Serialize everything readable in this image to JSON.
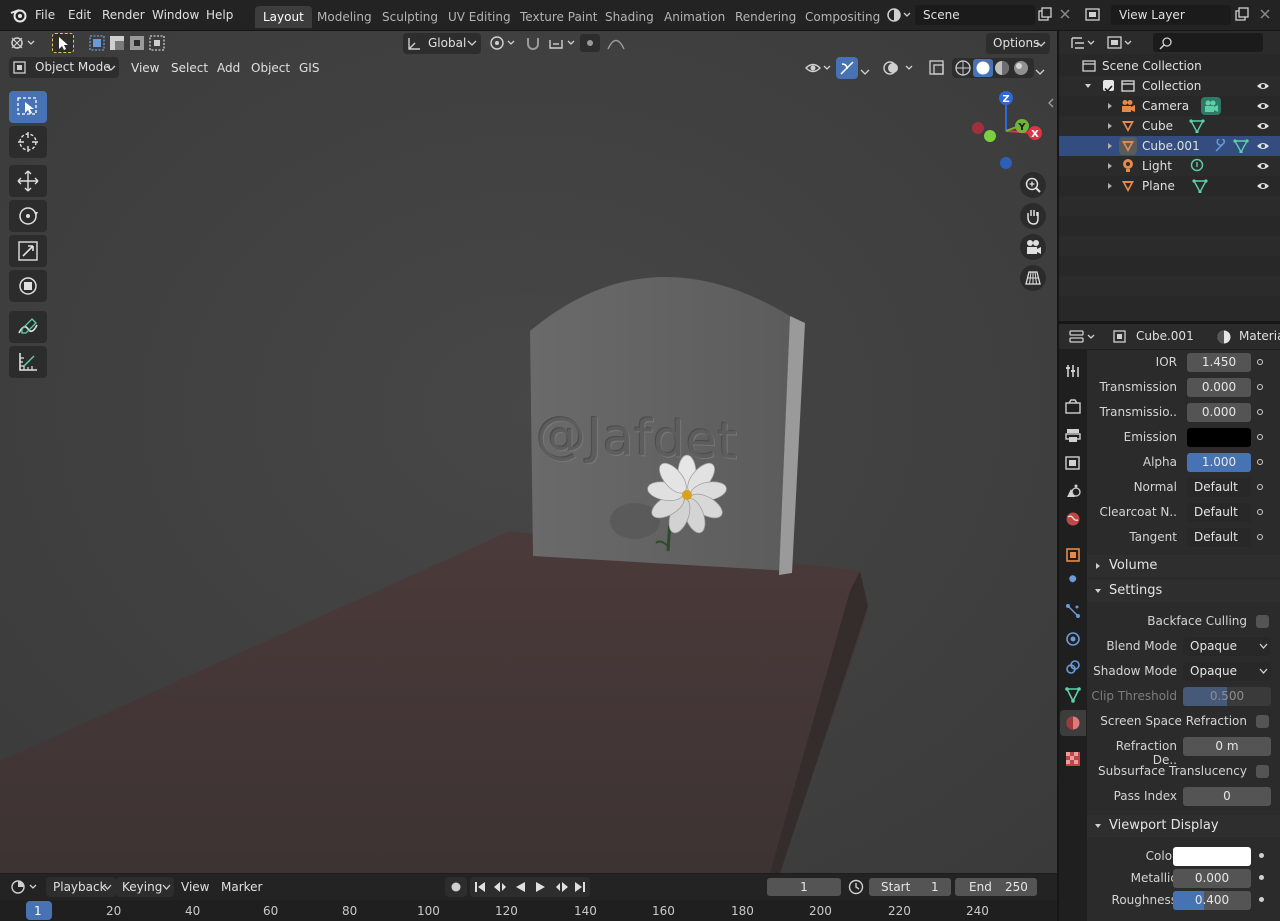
{
  "topbar": {
    "menus": [
      "File",
      "Edit",
      "Render",
      "Window",
      "Help"
    ],
    "workspaces": [
      "Layout",
      "Modeling",
      "Sculpting",
      "UV Editing",
      "Texture Paint",
      "Shading",
      "Animation",
      "Rendering",
      "Compositing"
    ],
    "active_workspace": "Layout",
    "scene": "Scene",
    "view_layer": "View Layer"
  },
  "viewport_header": {
    "transform_orientation": "Global",
    "options": "Options",
    "mode": "Object Mode",
    "menus": [
      "View",
      "Select",
      "Add",
      "Object",
      "GIS"
    ]
  },
  "scene": {
    "engraving": "@Jafdet"
  },
  "outliner": {
    "root": "Scene Collection",
    "collection": "Collection",
    "objects": [
      "Camera",
      "Cube",
      "Cube.001",
      "Light",
      "Plane"
    ],
    "selected": "Cube.001"
  },
  "properties": {
    "object": "Cube.001",
    "tab": "Materia",
    "rows": [
      {
        "label": "IOR",
        "value": "1.450"
      },
      {
        "label": "Transmission",
        "value": "0.000"
      },
      {
        "label": "Transmissio..",
        "value": "0.000"
      },
      {
        "label": "Emission",
        "value": ""
      },
      {
        "label": "Alpha",
        "value": "1.000"
      },
      {
        "label": "Normal",
        "value": "Default"
      },
      {
        "label": "Clearcoat N..",
        "value": "Default"
      },
      {
        "label": "Tangent",
        "value": "Default"
      }
    ],
    "sections": {
      "volume": "Volume",
      "settings": "Settings",
      "viewport_display": "Viewport Display"
    },
    "settings": {
      "backface_culling": "Backface Culling",
      "blend_mode_label": "Blend Mode",
      "blend_mode": "Opaque",
      "shadow_mode_label": "Shadow Mode",
      "shadow_mode": "Opaque",
      "clip_threshold_label": "Clip Threshold",
      "clip_threshold": "0.500",
      "ssr": "Screen Space Refraction",
      "refraction_depth_label": "Refraction De..",
      "refraction_depth": "0 m",
      "subsurface": "Subsurface Translucency",
      "pass_index_label": "Pass Index",
      "pass_index": "0"
    },
    "viewport_display": {
      "color_label": "Color",
      "metallic_label": "Metallic",
      "metallic": "0.000",
      "roughness_label": "Roughness",
      "roughness": "0.400"
    }
  },
  "timeline": {
    "menus": [
      "Playback",
      "Keying",
      "View",
      "Marker"
    ],
    "current_frame": "1",
    "start_label": "Start",
    "start": "1",
    "end_label": "End",
    "end": "250",
    "ruler": [
      "1",
      "20",
      "40",
      "60",
      "80",
      "100",
      "120",
      "140",
      "160",
      "180",
      "200",
      "220",
      "240"
    ]
  },
  "colors": {
    "accent": "#4772b3",
    "selected_row": "#334d80",
    "object_orange": "#e6894a",
    "data_green": "#5ed0a8"
  }
}
